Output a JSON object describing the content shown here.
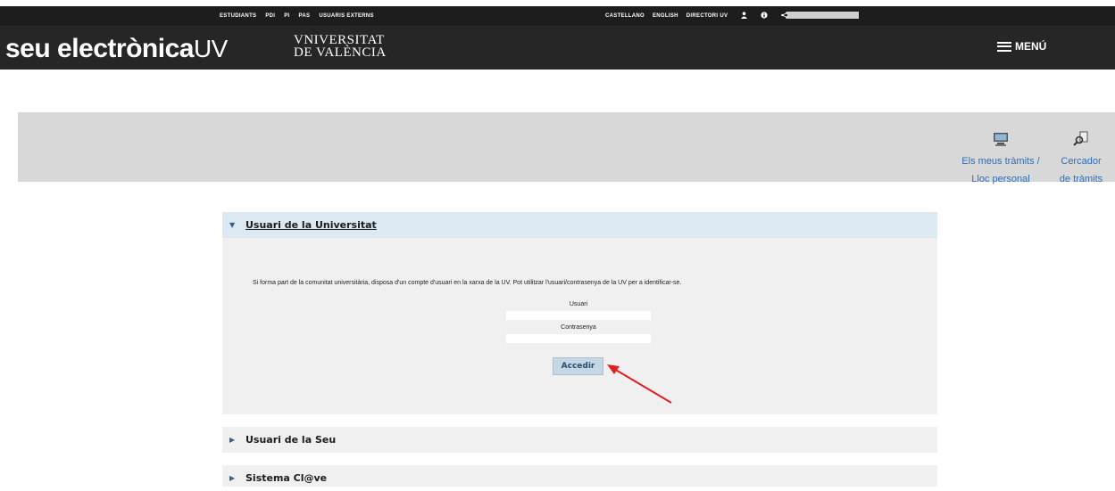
{
  "topbar": {
    "left_links": [
      "ESTUDIANTS",
      "PDI",
      "PI",
      "PAS",
      "USUARIS EXTERNS"
    ],
    "right_links": [
      "CASTELLANO",
      "ENGLISH",
      "DIRECTORI UV"
    ],
    "icons": [
      "user-icon",
      "info-icon",
      "share-icon"
    ]
  },
  "header": {
    "logo_main": "seu electrònica",
    "logo_suffix": "UV",
    "university_line1": "VNIVERSITAT",
    "university_line2": "DE VALÈNCIA",
    "menu_label": "MENÚ"
  },
  "tools": {
    "my_procedures_line1": "Els meus tràmits /",
    "my_procedures_line2": "Lloc personal",
    "search_line1": "Cercador",
    "search_line2": "de tràmits"
  },
  "login": {
    "university_user_title": "Usuari de la Universitat",
    "intro_text": "Si forma part de la comunitat universitària, disposa d'un compte d'usuari en la xarxa de la UV. Pot utilitzar l'usuari/contrasenya de la UV per a identificar-se.",
    "user_label": "Usuari",
    "password_label": "Contrasenya",
    "user_value": "",
    "password_value": "",
    "submit_label": "Accedir",
    "seu_user_title": "Usuari de la Seu",
    "clave_title": "Sistema Cl@ve"
  },
  "colors": {
    "accent_link": "#2a6ebb",
    "header_bg": "#262626",
    "panel_header_open": "#dce8f2",
    "annotation_arrow": "#e02020"
  }
}
